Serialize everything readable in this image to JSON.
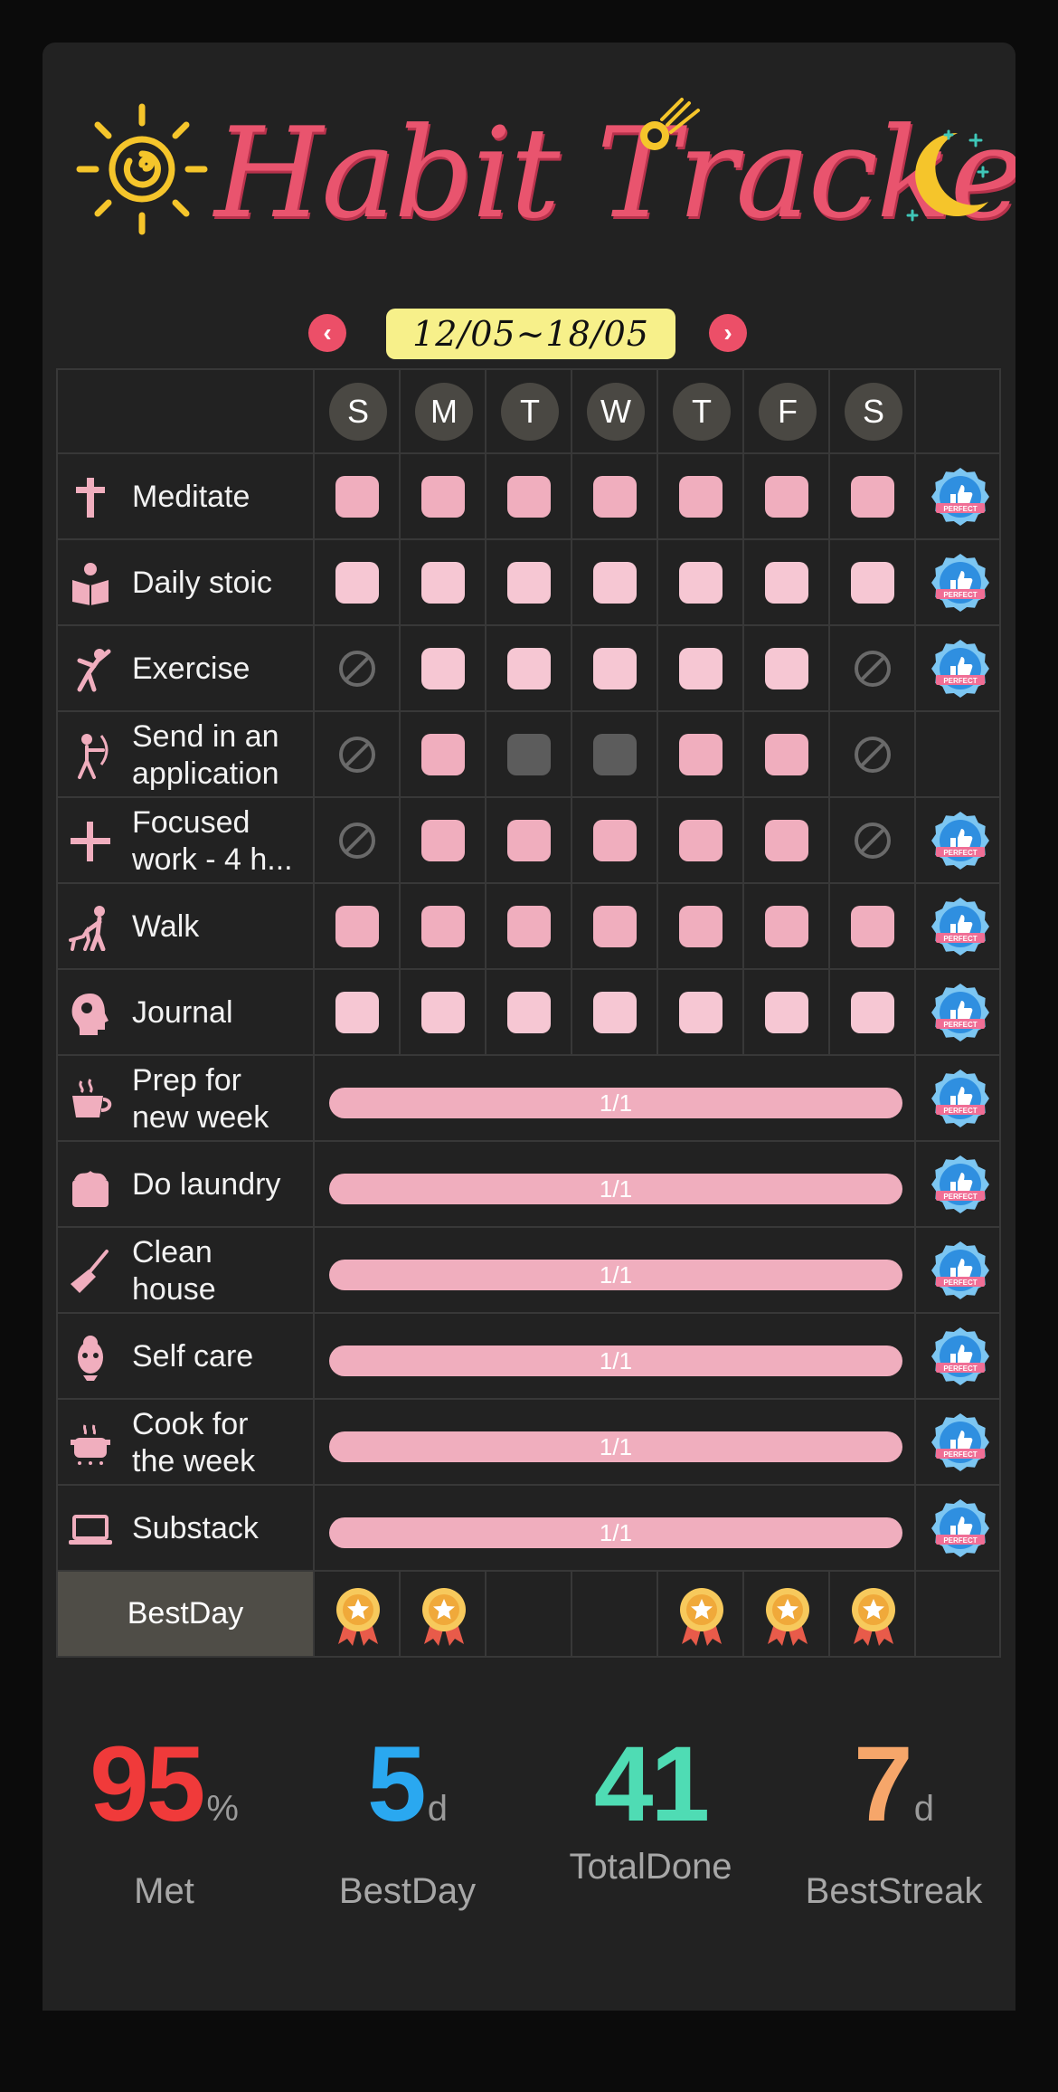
{
  "header": {
    "title": "Habit Tracker",
    "week_range": "12/05~18/05",
    "prev_label": "‹",
    "next_label": "›"
  },
  "days": [
    "S",
    "M",
    "T",
    "W",
    "T",
    "F",
    "S"
  ],
  "habits": [
    {
      "name": "Meditate",
      "icon": "cross-icon",
      "type": "daily",
      "days": [
        "done",
        "done",
        "done",
        "done",
        "done",
        "done",
        "done"
      ],
      "perfect": true,
      "shade": "dark"
    },
    {
      "name": "Daily stoic",
      "icon": "reading-person-icon",
      "type": "daily",
      "days": [
        "done",
        "done",
        "done",
        "done",
        "done",
        "done",
        "done"
      ],
      "perfect": true,
      "shade": "light"
    },
    {
      "name": "Exercise",
      "icon": "stretching-person-icon",
      "type": "daily",
      "days": [
        "skip",
        "done",
        "done",
        "done",
        "done",
        "done",
        "skip"
      ],
      "perfect": true,
      "shade": "light"
    },
    {
      "name": "Send in an\napplication",
      "icon": "archer-icon",
      "type": "daily",
      "days": [
        "skip",
        "done",
        "miss",
        "miss",
        "done",
        "done",
        "skip"
      ],
      "perfect": false,
      "shade": "dark"
    },
    {
      "name": "Focused\nwork - 4 h...",
      "icon": "plus-icon",
      "type": "daily",
      "days": [
        "skip",
        "done",
        "done",
        "done",
        "done",
        "done",
        "skip"
      ],
      "perfect": true,
      "shade": "dark"
    },
    {
      "name": "Walk",
      "icon": "dog-walker-icon",
      "type": "daily",
      "days": [
        "done",
        "done",
        "done",
        "done",
        "done",
        "done",
        "done"
      ],
      "perfect": true,
      "shade": "dark"
    },
    {
      "name": "Journal",
      "icon": "head-profile-icon",
      "type": "daily",
      "days": [
        "done",
        "done",
        "done",
        "done",
        "done",
        "done",
        "done"
      ],
      "perfect": true,
      "shade": "light"
    },
    {
      "name": "Prep for\nnew week",
      "icon": "cup-icon",
      "type": "weekly",
      "progress": "1/1",
      "perfect": true
    },
    {
      "name": "Do laundry",
      "icon": "laundry-basket-icon",
      "type": "weekly",
      "progress": "1/1",
      "perfect": true
    },
    {
      "name": "Clean\nhouse",
      "icon": "broom-icon",
      "type": "weekly",
      "progress": "1/1",
      "perfect": true
    },
    {
      "name": "Self care",
      "icon": "face-mask-icon",
      "type": "weekly",
      "progress": "1/1",
      "perfect": true
    },
    {
      "name": "Cook for\nthe week",
      "icon": "cooking-pot-icon",
      "type": "weekly",
      "progress": "1/1",
      "perfect": true
    },
    {
      "name": "Substack",
      "icon": "laptop-icon",
      "type": "weekly",
      "progress": "1/1",
      "perfect": true
    }
  ],
  "bestday": {
    "label": "BestDay",
    "medals": [
      true,
      true,
      false,
      false,
      true,
      true,
      true
    ]
  },
  "badge_text": "PERFECT",
  "stats": [
    {
      "value": "95",
      "unit": "%",
      "label": "Met",
      "color": "#f03a3a"
    },
    {
      "value": "5",
      "unit": "d",
      "label": "BestDay",
      "color": "#2aa8f0"
    },
    {
      "value": "41",
      "unit": "",
      "label": "TotalDone",
      "color": "#4fdcb4"
    },
    {
      "value": "7",
      "unit": "d",
      "label": "BestStreak",
      "color": "#f6a66a"
    }
  ],
  "colors": {
    "accent": "#e9546e",
    "done": "#f0aebe",
    "done_light": "#f6c7d3",
    "background": "#222222"
  }
}
